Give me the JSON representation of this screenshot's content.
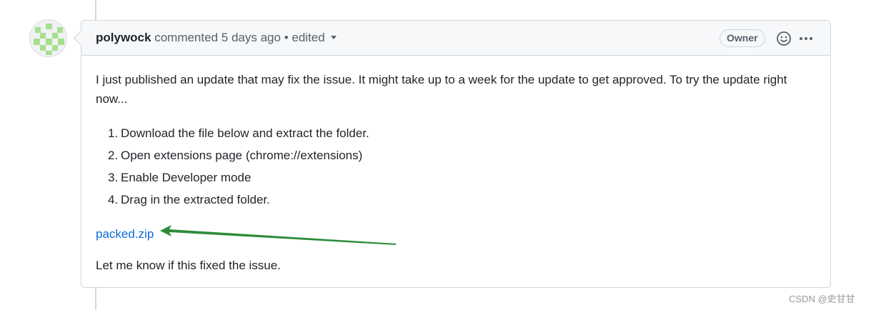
{
  "comment": {
    "author": "polywock",
    "action": "commented",
    "time": "5 days ago",
    "separator": "•",
    "edited": "edited",
    "badge": "Owner",
    "body": {
      "intro": "I just published an update that may fix the issue. It might take up to a week for the update to get approved. To try the update right now...",
      "steps": [
        {
          "num": "1.",
          "text": "Download the file below and extract the folder."
        },
        {
          "num": "2.",
          "text": "Open extensions page (chrome://extensions)"
        },
        {
          "num": "3.",
          "text": "Enable Developer mode"
        },
        {
          "num": "4.",
          "text": "Drag in the extracted folder."
        }
      ],
      "attachment": "packed.zip",
      "closing": "Let me know if this fixed the issue."
    }
  },
  "icons": {
    "reaction": "smiley-icon",
    "menu": "kebab-horizontal-icon",
    "dropdown": "chevron-down-icon"
  },
  "colors": {
    "link": "#0969da",
    "annotation_arrow": "#2e8b3a",
    "avatar_green": "#a6e08f"
  },
  "watermark": "CSDN @史甘甘"
}
